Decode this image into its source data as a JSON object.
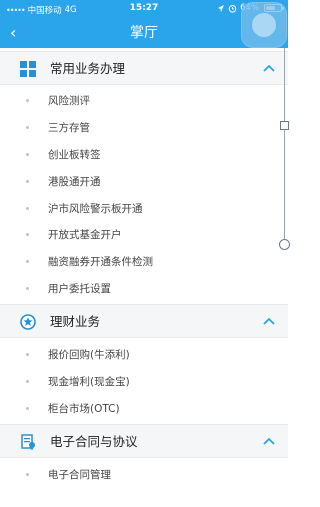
{
  "status_bar": {
    "signal": "•••••",
    "carrier": "中国移动",
    "network": "4G",
    "time": "15:27",
    "battery": "64%",
    "battery_level": 0.64
  },
  "nav": {
    "back": "‹",
    "title": "掌厅"
  },
  "sections": [
    {
      "title": "常用业务办理",
      "icon": "grid-icon",
      "expanded": true,
      "items": [
        "风险测评",
        "三方存管",
        "创业板转签",
        "港股通开通",
        "沪市风险警示板开通",
        "开放式基金开户",
        "融资融券开通条件检测",
        "用户委托设置"
      ]
    },
    {
      "title": "理财业务",
      "icon": "star-badge-icon",
      "expanded": true,
      "items": [
        "报价回购(牛添利)",
        "现金增利(现金宝)",
        "柜台市场(OTC)"
      ]
    },
    {
      "title": "电子合同与协议",
      "icon": "contract-icon",
      "expanded": true,
      "items": [
        "电子合同管理"
      ]
    }
  ],
  "colors": {
    "brand": "#2aa4ea",
    "section_bg": "#f4f6f8"
  }
}
